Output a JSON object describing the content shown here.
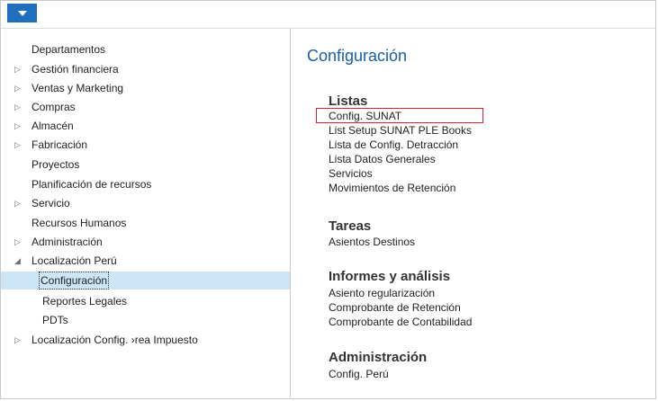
{
  "menu_button": {
    "icon": "caret-down-icon"
  },
  "nav": {
    "items": [
      {
        "label": "Departamentos",
        "expander": ""
      },
      {
        "label": "Gestión financiera",
        "expander": "▷"
      },
      {
        "label": "Ventas y Marketing",
        "expander": "▷"
      },
      {
        "label": "Compras",
        "expander": "▷"
      },
      {
        "label": "Almacén",
        "expander": "▷"
      },
      {
        "label": "Fabricación",
        "expander": "▷"
      },
      {
        "label": "Proyectos",
        "expander": ""
      },
      {
        "label": "Planificación de recursos",
        "expander": ""
      },
      {
        "label": "Servicio",
        "expander": "▷"
      },
      {
        "label": "Recursos Humanos",
        "expander": ""
      },
      {
        "label": "Administración",
        "expander": "▷"
      },
      {
        "label": "Localización Perú",
        "expander": "◢"
      },
      {
        "label": "Configuración",
        "expander": ""
      },
      {
        "label": "Reportes Legales",
        "expander": ""
      },
      {
        "label": "PDTs",
        "expander": ""
      },
      {
        "label": "Localización Config. ›rea Impuesto",
        "expander": "▷"
      }
    ]
  },
  "content": {
    "title": "Configuración",
    "sections": [
      {
        "title": "Listas",
        "links": [
          "Config. SUNAT",
          "List Setup SUNAT PLE Books",
          "Lista de Config. Detracción",
          "Lista Datos Generales",
          "Servicios",
          "Movimientos de Retención"
        ]
      },
      {
        "title": "Tareas",
        "links": [
          "Asientos Destinos"
        ]
      },
      {
        "title": "Informes y análisis",
        "links": [
          "Asiento regularización",
          "Comprobante de Retención",
          "Comprobante de Contabilidad"
        ]
      },
      {
        "title": "Administración",
        "links": [
          "Config. Perú"
        ]
      }
    ]
  },
  "colors": {
    "accent": "#1f6fbd",
    "title": "#1a5ea8",
    "selected_bg": "#cde6f7",
    "highlight_border": "#d9232e"
  }
}
